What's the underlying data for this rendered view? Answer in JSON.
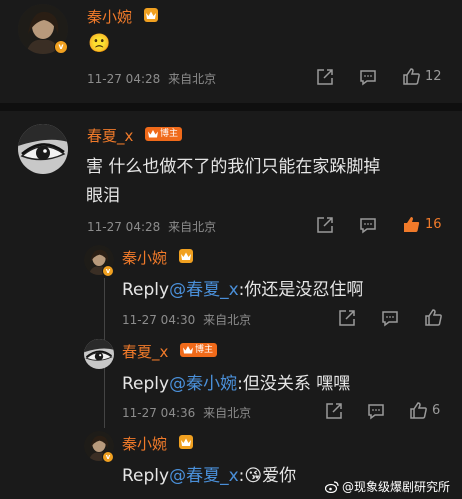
{
  "comment1": {
    "username": "秦小婉",
    "emoji": "🙁",
    "time": "11-27 04:28",
    "source": "来自北京",
    "likes": "12"
  },
  "comment2": {
    "username": "春夏_x",
    "blogger_badge": "博主",
    "text_line1": "害 什么也做不了的我们只能在家跺脚掉",
    "text_line2": "眼泪",
    "time": "11-27 04:28",
    "source": "来自北京",
    "likes": "16"
  },
  "replies": [
    {
      "username": "秦小婉",
      "prefix": "Reply",
      "mention": "@春夏_x",
      "body": ":你还是没忍住啊",
      "time": "11-27 04:30",
      "source": "来自北京",
      "likes": ""
    },
    {
      "username": "春夏_x",
      "blogger_badge": "博主",
      "prefix": "Reply",
      "mention": "@秦小婉",
      "body": ":但没关系 嘿嘿",
      "time": "11-27 04:36",
      "source": "来自北京",
      "likes": "6"
    },
    {
      "username": "秦小婉",
      "prefix": "Reply",
      "mention": "@春夏_x",
      "emoji": "😘",
      "body": "爱你"
    }
  ],
  "watermark": "@现象级爆剧研究所",
  "colors": {
    "background": "#1a1a1a",
    "username": "#f07a2a",
    "mention": "#4a8fd8",
    "liked": "#f07a2a",
    "meta": "#8c8c8c"
  }
}
